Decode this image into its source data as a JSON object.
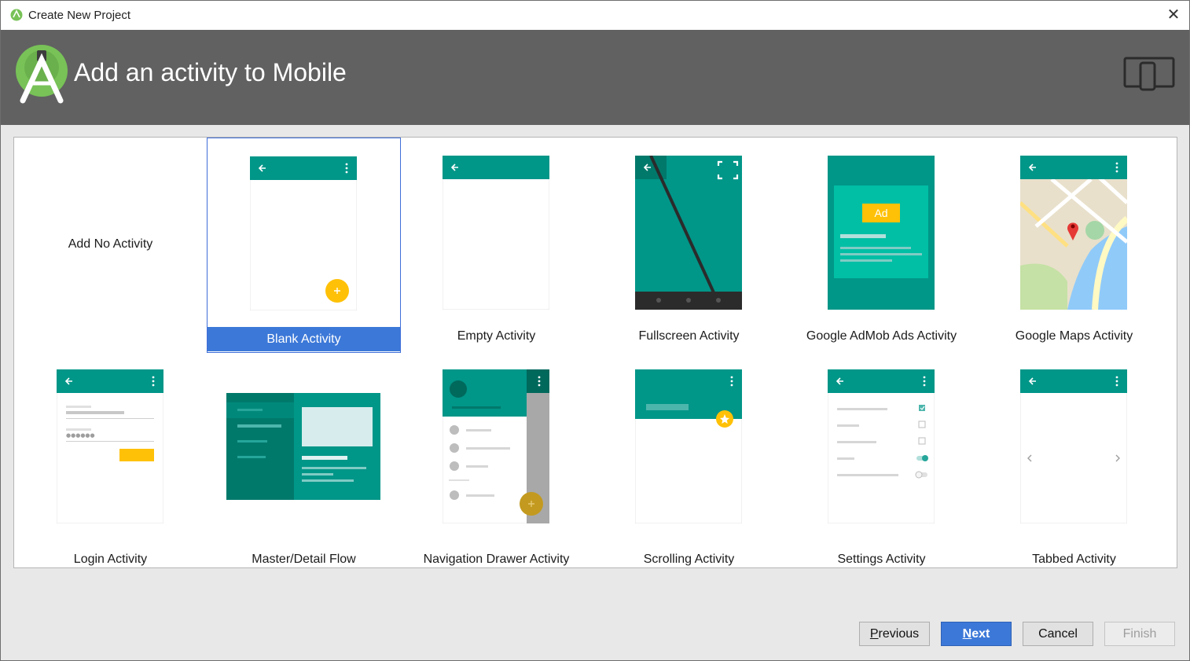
{
  "window": {
    "title": "Create New Project",
    "app_icon": "android-studio-icon",
    "close_icon": "close-icon"
  },
  "header": {
    "title": "Add an activity to Mobile",
    "logo_icon": "android-studio-logo-icon",
    "device_icon": "phone-tablet-icon"
  },
  "gallery": {
    "selected": "Blank Activity",
    "items": [
      {
        "label": "Add No Activity"
      },
      {
        "label": "Blank Activity"
      },
      {
        "label": "Empty Activity"
      },
      {
        "label": "Fullscreen Activity"
      },
      {
        "label": "Google AdMob Ads Activity"
      },
      {
        "label": "Google Maps Activity"
      },
      {
        "label": "Login Activity"
      },
      {
        "label": "Master/Detail Flow"
      },
      {
        "label": "Navigation Drawer Activity"
      },
      {
        "label": "Scrolling Activity"
      },
      {
        "label": "Settings Activity"
      },
      {
        "label": "Tabbed Activity"
      }
    ],
    "ad_badge": "Ad",
    "password_mask": "●●●●●●"
  },
  "buttons": {
    "previous": {
      "mnemonic": "P",
      "rest": "revious"
    },
    "next": {
      "mnemonic": "N",
      "rest": "ext"
    },
    "cancel": "Cancel",
    "finish": "Finish"
  },
  "colors": {
    "teal": "#009688",
    "teal_dark": "#00796b",
    "accent_yellow": "#ffc107",
    "selection_blue": "#3c78d8",
    "header_gray": "#616161"
  }
}
